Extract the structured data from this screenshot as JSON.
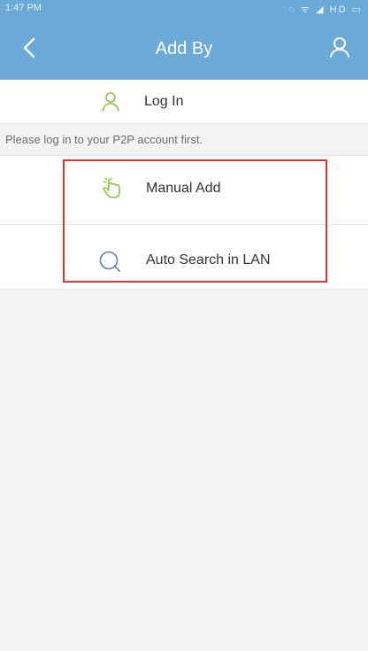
{
  "status_bar": {
    "time": "1:47 PM",
    "indicators": "◌ ᯤ ◢ HD ▭"
  },
  "app_bar": {
    "title": "Add By",
    "background_color": "#6aa9d8",
    "back_icon": "chevron-left-icon",
    "user_icon": "user-icon"
  },
  "login": {
    "label": "Log In",
    "icon": "user-icon",
    "hint": "Please log in to your P2P account first."
  },
  "options": {
    "manual_add": {
      "label": "Manual Add",
      "icon": "hand-pointer-icon",
      "icon_color": "#8cc63f"
    },
    "auto_search": {
      "label": "Auto Search in LAN",
      "icon": "search-icon",
      "icon_color": "#6b7bbf"
    }
  },
  "highlight": {
    "color": "#e03434"
  }
}
